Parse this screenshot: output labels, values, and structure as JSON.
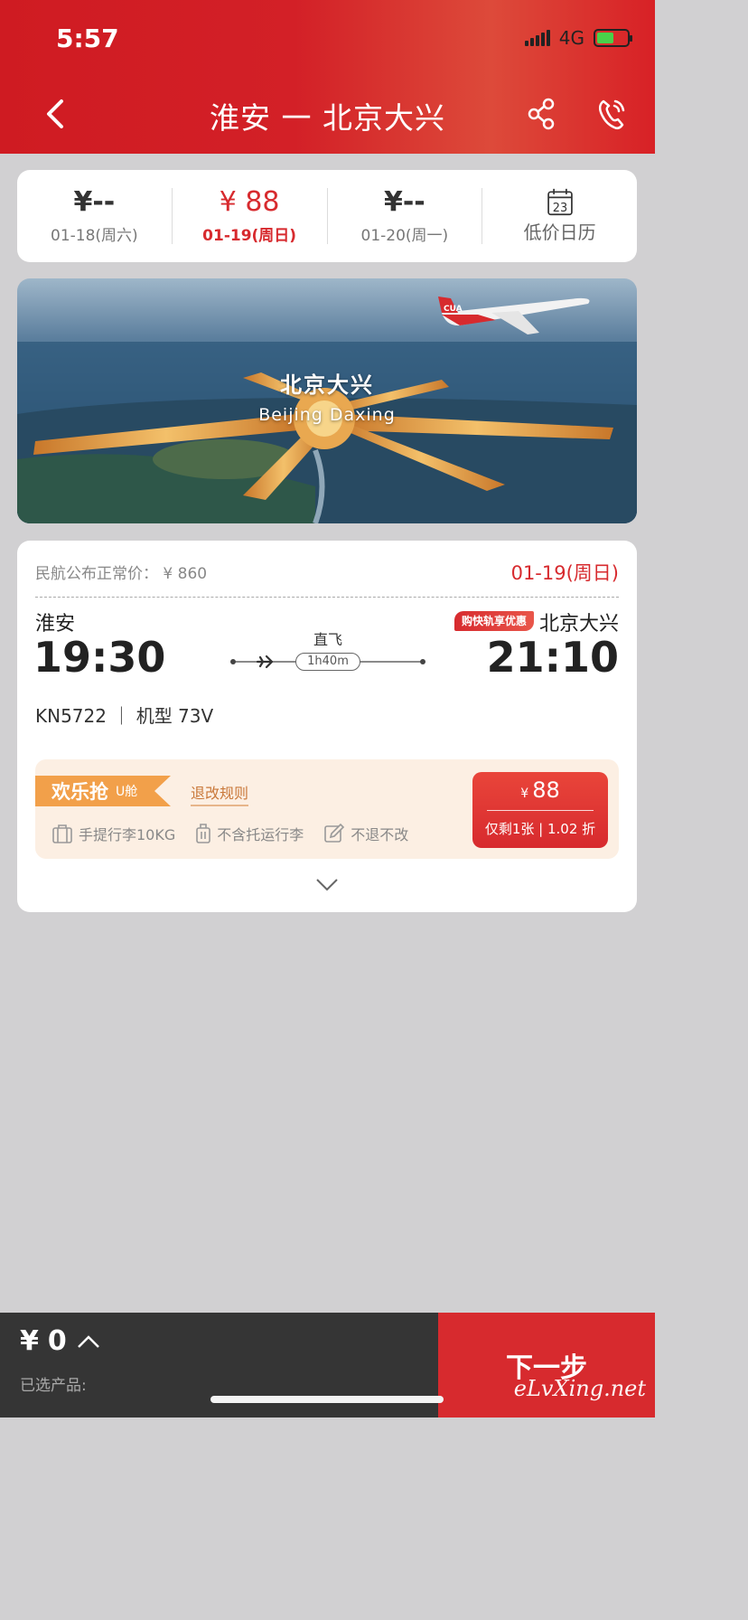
{
  "status": {
    "time": "5:57",
    "network": "4G"
  },
  "nav": {
    "title": "淮安 一 北京大兴"
  },
  "dates": [
    {
      "price": "¥--",
      "label": "01-18(周六)",
      "active": false
    },
    {
      "price": "¥ 88",
      "label": "01-19(周日)",
      "active": true
    },
    {
      "price": "¥--",
      "label": "01-20(周一)",
      "active": false
    }
  ],
  "calendar": {
    "day": "23",
    "label": "低价日历"
  },
  "banner": {
    "cn": "北京大兴",
    "en": "Beijing Daxing",
    "plane_logo": "CUA"
  },
  "flight": {
    "ref_price": "民航公布正常价： ¥ 860",
    "date": "01-19(周日)",
    "dep_city": "淮安",
    "arr_city": "北京大兴",
    "dep_time": "19:30",
    "arr_time": "21:10",
    "promo": "购快轨享优惠",
    "direct": "直飞",
    "duration": "1h40m",
    "info": "KN5722 ｜ 机型 73V"
  },
  "fare": {
    "tag": "欢乐抢",
    "cabin": "U舱",
    "rule": "退改规则",
    "features": [
      "手提行李10KG",
      "不含托运行李",
      "不退不改"
    ],
    "currency": "¥",
    "price": "88",
    "remain": "仅剩1张 | 1.02 折"
  },
  "bottom": {
    "currency": "¥",
    "total": "0",
    "selected": "已选产品:",
    "next": "下一步",
    "watermark": "eLvXing.net"
  },
  "colors": {
    "primary": "#d72a2e",
    "fare_bg": "#fcefe3",
    "fare_tag": "#f2a04a"
  }
}
